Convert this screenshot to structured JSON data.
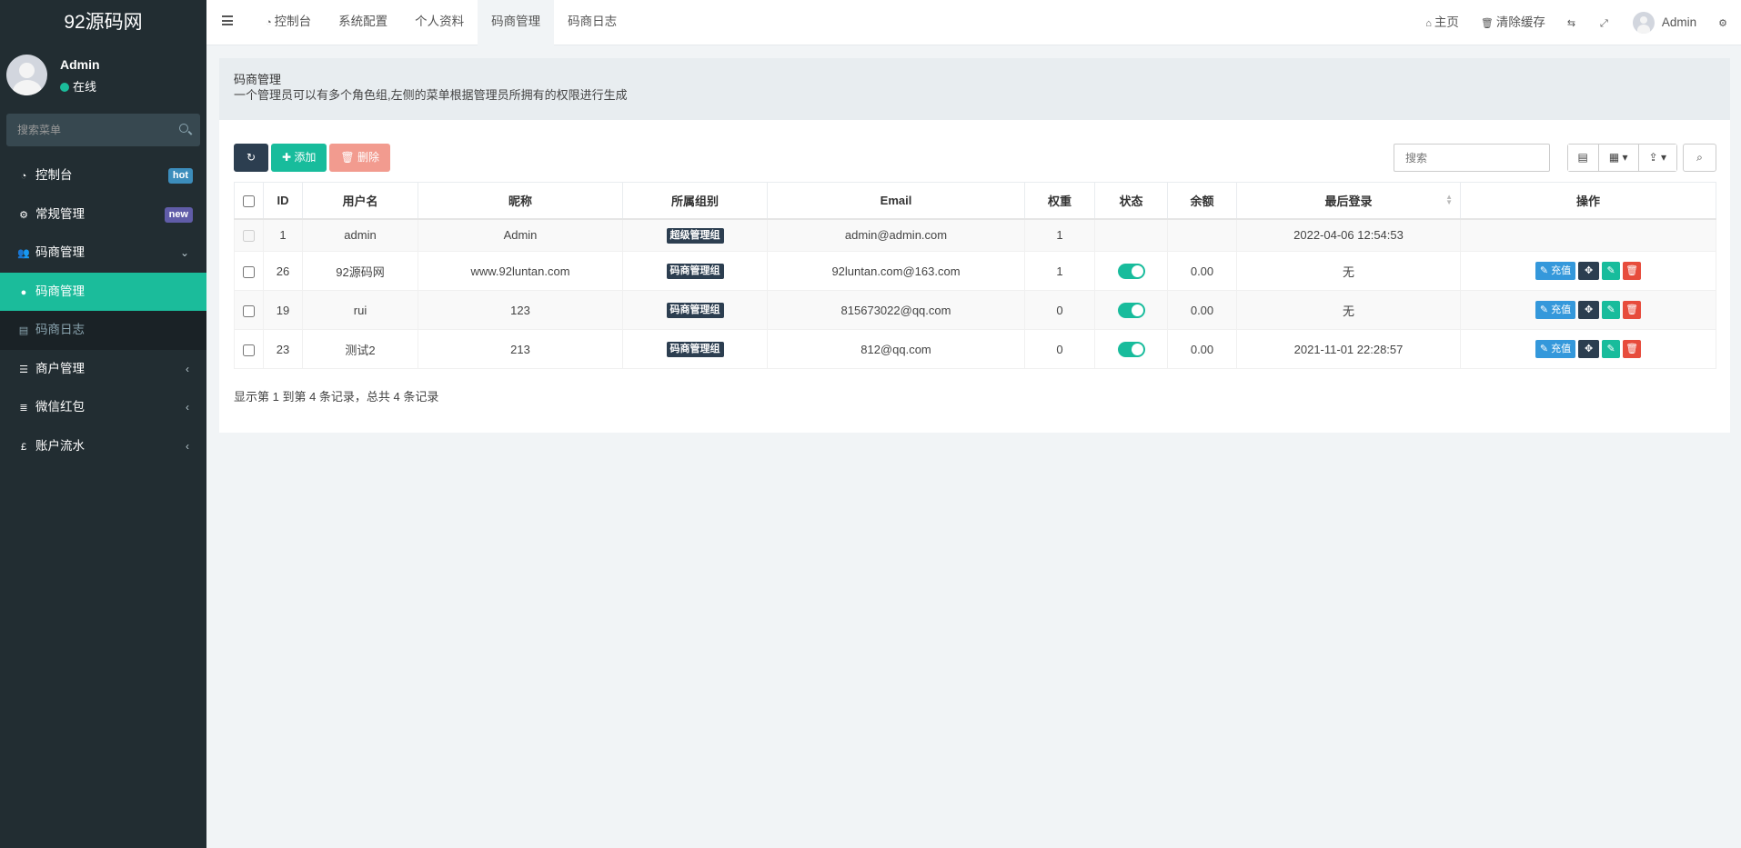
{
  "sidebar": {
    "logo": "92源码网",
    "user_name": "Admin",
    "status": "在线",
    "search_placeholder": "搜索菜单",
    "items": [
      {
        "label": "控制台",
        "icon": "dashboard-icon",
        "badge": "hot",
        "badge_color": "#3c8dbc"
      },
      {
        "label": "常规管理",
        "icon": "cogs-icon",
        "badge": "new",
        "badge_color": "#605ca8"
      },
      {
        "label": "码商管理",
        "icon": "group-icon",
        "expanded": true
      },
      {
        "label": "码商管理",
        "icon": "user-icon",
        "active": true
      },
      {
        "label": "码商日志",
        "icon": "list-alt-icon"
      },
      {
        "label": "商户管理",
        "icon": "list-icon"
      },
      {
        "label": "微信红包",
        "icon": "database-icon"
      },
      {
        "label": "账户流水",
        "icon": "gbp-icon"
      }
    ]
  },
  "header": {
    "tabs": [
      {
        "label": "控制台",
        "icon": "dashboard-icon"
      },
      {
        "label": "系统配置"
      },
      {
        "label": "个人资料"
      },
      {
        "label": "码商管理",
        "active": true
      },
      {
        "label": "码商日志"
      }
    ],
    "home": "主页",
    "clear_cache": "清除缓存",
    "user": "Admin"
  },
  "page": {
    "title": "码商管理",
    "description": "一个管理员可以有多个角色组,左侧的菜单根据管理员所拥有的权限进行生成"
  },
  "toolbar": {
    "add_label": "添加",
    "delete_label": "删除",
    "search_placeholder": "搜索"
  },
  "table": {
    "columns": [
      "ID",
      "用户名",
      "昵称",
      "所属组别",
      "Email",
      "权重",
      "状态",
      "余额",
      "最后登录",
      "操作"
    ],
    "charge_label": "充值",
    "rows": [
      {
        "id": "1",
        "username": "admin",
        "nickname": "Admin",
        "group": "超级管理组",
        "email": "admin@admin.com",
        "weight": "1",
        "status": "",
        "balance": "",
        "last_login": "2022-04-06 12:54:53",
        "ops": false
      },
      {
        "id": "26",
        "username": "92源码网",
        "nickname": "www.92luntan.com",
        "group": "码商管理组",
        "email": "92luntan.com@163.com",
        "weight": "1",
        "status": "on",
        "balance": "0.00",
        "last_login": "无",
        "ops": true
      },
      {
        "id": "19",
        "username": "rui",
        "nickname": "123",
        "group": "码商管理组",
        "email": "815673022@qq.com",
        "weight": "0",
        "status": "on",
        "balance": "0.00",
        "last_login": "无",
        "ops": true
      },
      {
        "id": "23",
        "username": "测试2",
        "nickname": "213",
        "group": "码商管理组",
        "email": "812@qq.com",
        "weight": "0",
        "status": "on",
        "balance": "0.00",
        "last_login": "2021-11-01 22:28:57",
        "ops": true
      }
    ]
  },
  "pagination": {
    "info": "显示第 1 到第 4 条记录，总共 4 条记录"
  }
}
